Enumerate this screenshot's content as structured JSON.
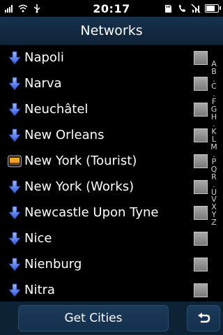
{
  "status_bar": {
    "time": "20:17",
    "icons_left": [
      "signal-bars-icon",
      "wifi-icon",
      "usb-icon"
    ],
    "icons_right": [
      "sd-card-icon",
      "phone-icon",
      "no-signal-icon",
      "battery-icon"
    ]
  },
  "header": {
    "title": "Networks"
  },
  "networks": [
    {
      "label": "Napoli",
      "icon": "download-arrow-icon",
      "checked": false
    },
    {
      "label": "Narva",
      "icon": "download-arrow-icon",
      "checked": false
    },
    {
      "label": "Neuchâtel",
      "icon": "download-arrow-icon",
      "checked": false
    },
    {
      "label": "New Orleans",
      "icon": "download-arrow-icon",
      "checked": false
    },
    {
      "label": "New York (Tourist)",
      "icon": "installed-map-icon",
      "checked": false
    },
    {
      "label": "New York (Works)",
      "icon": "download-arrow-icon",
      "checked": false
    },
    {
      "label": "Newcastle Upon Tyne",
      "icon": "download-arrow-icon",
      "checked": false
    },
    {
      "label": "Nice",
      "icon": "download-arrow-icon",
      "checked": false
    },
    {
      "label": "Nienburg",
      "icon": "download-arrow-icon",
      "checked": false
    },
    {
      "label": "Nitra",
      "icon": "download-arrow-icon",
      "checked": false
    }
  ],
  "alphabet_index": [
    "A",
    "B",
    ".",
    "C",
    ".",
    "F",
    "G",
    "H",
    ".",
    "K",
    "L",
    "M",
    ".",
    "P",
    "Q",
    "R",
    ".",
    "U",
    "V",
    "X",
    "Y",
    "Z"
  ],
  "bottom_bar": {
    "get_cities_label": "Get Cities",
    "back_icon": "back-arrow-icon"
  },
  "colors": {
    "header_bg": "#17324d",
    "bottom_bg": "#0e2236",
    "arrow_blue": "#3f6de0"
  }
}
